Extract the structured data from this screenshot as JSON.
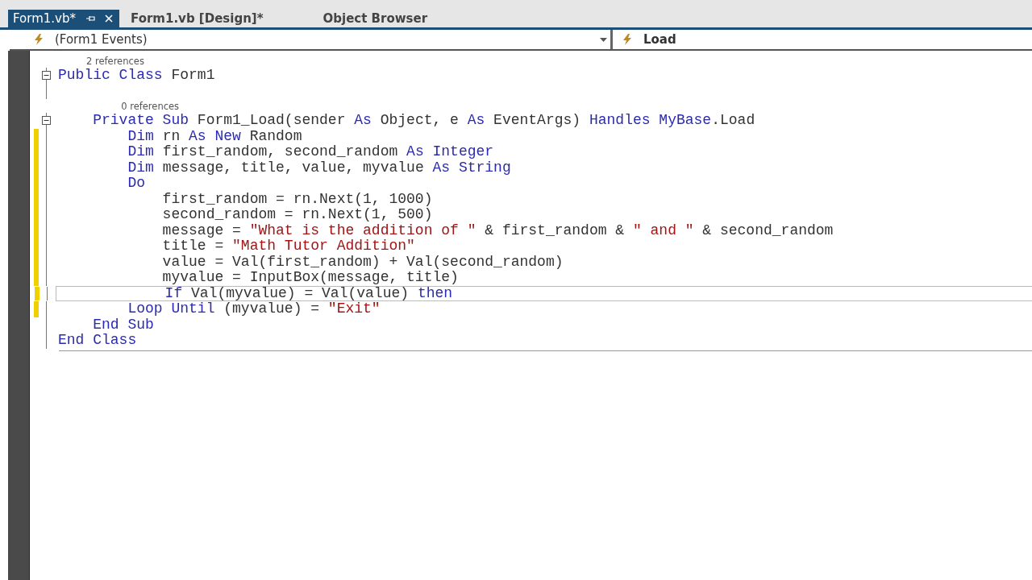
{
  "tabs": [
    {
      "label": "Form1.vb*",
      "selected": true,
      "pinned": true,
      "closable": true
    },
    {
      "label": "Form1.vb [Design]*",
      "selected": false,
      "pinned": false,
      "closable": false
    },
    {
      "label": "Object Browser",
      "selected": false,
      "pinned": false,
      "closable": false
    }
  ],
  "navigation_bar": {
    "type_dropdown": "(Form1 Events)",
    "member_dropdown": "Load"
  },
  "code_lines": [
    {
      "kind": "code",
      "codelens": "2 references",
      "fold": true,
      "changed": false,
      "current": false,
      "tokens": [
        {
          "kind": "keyword",
          "text": "Public Class "
        },
        {
          "kind": "plain",
          "text": "Form1"
        }
      ]
    },
    {
      "kind": "blank"
    },
    {
      "kind": "code",
      "codelens": "0 references",
      "fold": true,
      "changed": false,
      "current": false,
      "tokens": [
        {
          "kind": "keyword",
          "text": "    Private Sub "
        },
        {
          "kind": "plain",
          "text": "Form1_Load(sender "
        },
        {
          "kind": "keyword",
          "text": "As "
        },
        {
          "kind": "plain",
          "text": "Object, e "
        },
        {
          "kind": "keyword",
          "text": "As "
        },
        {
          "kind": "plain",
          "text": "EventArgs) "
        },
        {
          "kind": "keyword",
          "text": "Handles MyBase"
        },
        {
          "kind": "plain",
          "text": ".Load"
        }
      ]
    },
    {
      "kind": "code",
      "fold": false,
      "changed": true,
      "current": false,
      "tokens": [
        {
          "kind": "keyword",
          "text": "        Dim "
        },
        {
          "kind": "plain",
          "text": "rn "
        },
        {
          "kind": "keyword",
          "text": "As New "
        },
        {
          "kind": "plain",
          "text": "Random"
        }
      ]
    },
    {
      "kind": "code",
      "fold": false,
      "changed": true,
      "current": false,
      "tokens": [
        {
          "kind": "keyword",
          "text": "        Dim "
        },
        {
          "kind": "plain",
          "text": "first_random, second_random "
        },
        {
          "kind": "keyword",
          "text": "As Integer"
        }
      ]
    },
    {
      "kind": "code",
      "fold": false,
      "changed": true,
      "current": false,
      "tokens": [
        {
          "kind": "keyword",
          "text": "        Dim "
        },
        {
          "kind": "plain",
          "text": "message, title, value, myvalue "
        },
        {
          "kind": "keyword",
          "text": "As String"
        }
      ]
    },
    {
      "kind": "code",
      "fold": false,
      "changed": true,
      "current": false,
      "tokens": [
        {
          "kind": "keyword",
          "text": "        Do"
        }
      ]
    },
    {
      "kind": "code",
      "fold": false,
      "changed": true,
      "current": false,
      "tokens": [
        {
          "kind": "plain",
          "text": "            first_random = rn.Next(1, 1000)"
        }
      ]
    },
    {
      "kind": "code",
      "fold": false,
      "changed": true,
      "current": false,
      "tokens": [
        {
          "kind": "plain",
          "text": "            second_random = rn.Next(1, 500)"
        }
      ]
    },
    {
      "kind": "code",
      "fold": false,
      "changed": true,
      "current": false,
      "tokens": [
        {
          "kind": "plain",
          "text": "            message = "
        },
        {
          "kind": "string",
          "text": "\"What is the addition of \""
        },
        {
          "kind": "plain",
          "text": " & first_random & "
        },
        {
          "kind": "string",
          "text": "\" and \""
        },
        {
          "kind": "plain",
          "text": " & second_random"
        }
      ]
    },
    {
      "kind": "code",
      "fold": false,
      "changed": true,
      "current": false,
      "tokens": [
        {
          "kind": "plain",
          "text": "            title = "
        },
        {
          "kind": "string",
          "text": "\"Math Tutor Addition\""
        }
      ]
    },
    {
      "kind": "code",
      "fold": false,
      "changed": true,
      "current": false,
      "tokens": [
        {
          "kind": "plain",
          "text": "            value = Val(first_random) + Val(second_random)"
        }
      ]
    },
    {
      "kind": "code",
      "fold": false,
      "changed": true,
      "current": false,
      "tokens": [
        {
          "kind": "plain",
          "text": "            myvalue = InputBox(message, title)"
        }
      ]
    },
    {
      "kind": "code",
      "fold": false,
      "changed": true,
      "current": true,
      "tokens": [
        {
          "kind": "keyword",
          "text": "            If "
        },
        {
          "kind": "plain",
          "text": "Val(myvalue) = Val(value) "
        },
        {
          "kind": "keyword",
          "text": "then"
        }
      ]
    },
    {
      "kind": "code",
      "fold": false,
      "changed": true,
      "current": false,
      "tokens": [
        {
          "kind": "keyword",
          "text": "        Loop Until "
        },
        {
          "kind": "plain",
          "text": "(myvalue) = "
        },
        {
          "kind": "string",
          "text": "\"Exit\""
        }
      ]
    },
    {
      "kind": "code",
      "fold": false,
      "changed": false,
      "current": false,
      "tokens": [
        {
          "kind": "keyword",
          "text": "    End Sub"
        }
      ]
    },
    {
      "kind": "code",
      "fold": false,
      "changed": false,
      "current": false,
      "tokens": [
        {
          "kind": "keyword",
          "text": "End Class"
        }
      ]
    }
  ]
}
